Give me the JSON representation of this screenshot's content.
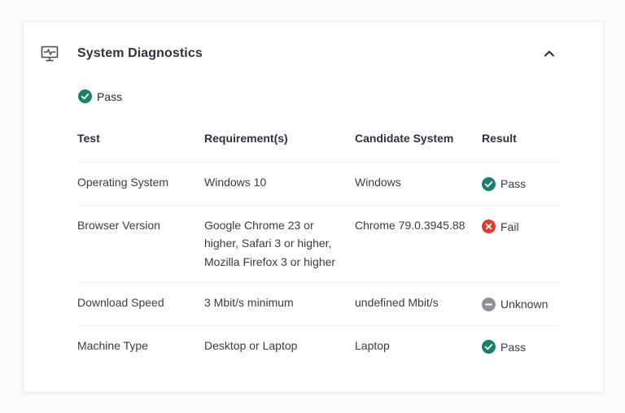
{
  "panel": {
    "title": "System Diagnostics",
    "overall_status": "Pass"
  },
  "table": {
    "headers": [
      "Test",
      "Requirement(s)",
      "Candidate System",
      "Result"
    ],
    "rows": [
      {
        "test": "Operating System",
        "requirement": "Windows 10",
        "candidate": "Windows",
        "result": "Pass",
        "result_icon": "check-circle-icon"
      },
      {
        "test": "Browser Version",
        "requirement": "Google Chrome 23 or higher, Safari 3 or higher, Mozilla Firefox 3 or higher",
        "candidate": "Chrome 79.0.3945.88",
        "result": "Fail",
        "result_icon": "x-circle-icon"
      },
      {
        "test": "Download Speed",
        "requirement": "3 Mbit/s minimum",
        "candidate": "undefined Mbit/s",
        "result": "Unknown",
        "result_icon": "minus-circle-icon"
      },
      {
        "test": "Machine Type",
        "requirement": "Desktop or Laptop",
        "candidate": "Laptop",
        "result": "Pass",
        "result_icon": "check-circle-icon"
      }
    ]
  },
  "colors": {
    "pass": "#1a7f6b",
    "fail": "#e0392e",
    "unknown": "#8f9196",
    "text": "#2b2d33"
  },
  "icons": {
    "header": "monitor-pulse-icon",
    "collapse": "chevron-up-icon"
  }
}
